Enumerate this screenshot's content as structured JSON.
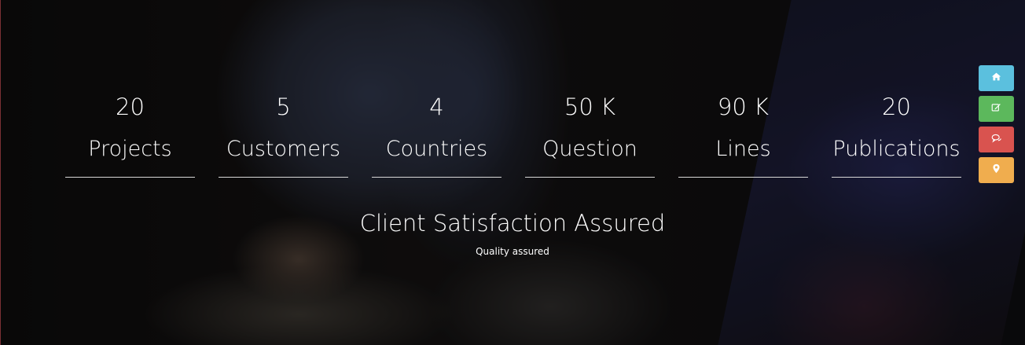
{
  "stats": [
    {
      "number": "20",
      "label": "Projects"
    },
    {
      "number": "5",
      "label": "Customers"
    },
    {
      "number": "4",
      "label": "Countries"
    },
    {
      "number": "50 K",
      "label": "Question"
    },
    {
      "number": "90 K",
      "label": "Lines"
    },
    {
      "number": "20",
      "label": "Publications"
    }
  ],
  "headline": "Client Satisfaction Assured",
  "subline": "Quality assured",
  "side_nav": [
    {
      "icon": "home-icon",
      "color": "#5bc0de"
    },
    {
      "icon": "edit-icon",
      "color": "#5cb85c"
    },
    {
      "icon": "comments-icon",
      "color": "#d9534f"
    },
    {
      "icon": "map-marker-icon",
      "color": "#f0ad4e"
    }
  ]
}
